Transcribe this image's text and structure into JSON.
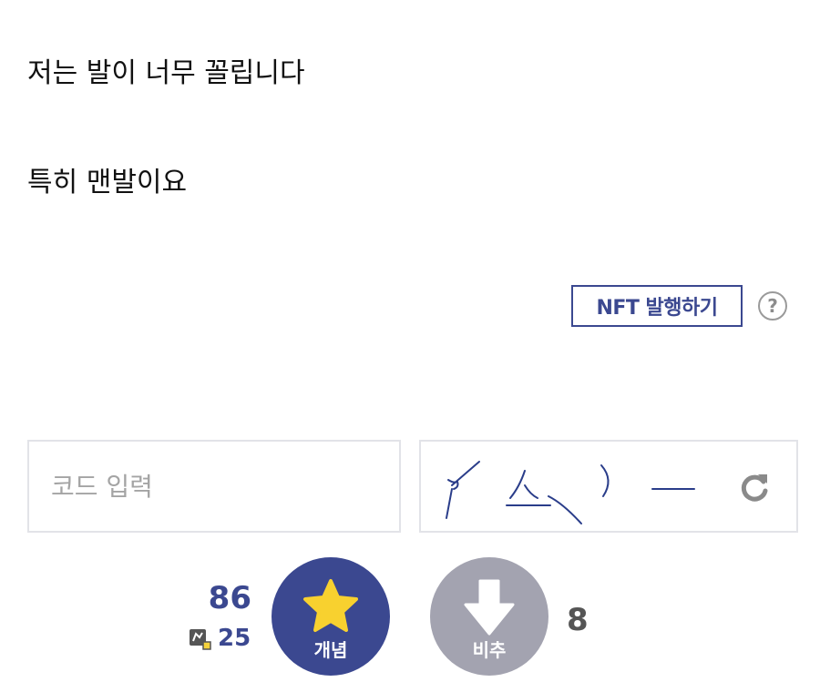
{
  "post": {
    "lines": [
      "저는 발이 너무 꼴립니다",
      "특히 맨발이요"
    ]
  },
  "nft": {
    "button_label": "NFT 발행하기",
    "help_label": "?"
  },
  "captcha": {
    "input_placeholder": "코드 입력",
    "input_value": "",
    "refresh_icon": "refresh-icon"
  },
  "vote": {
    "up_count": "86",
    "fixed_count": "25",
    "up_label": "개념",
    "down_label": "비추",
    "down_count": "8",
    "up_icon": "star-icon",
    "down_icon": "arrow-down-icon",
    "fixed_icon": "fixed-user-icon"
  },
  "colors": {
    "accent": "#3b4890",
    "star": "#f8d12f",
    "downvote": "#a3a3b0",
    "border": "#e2e3e8"
  }
}
